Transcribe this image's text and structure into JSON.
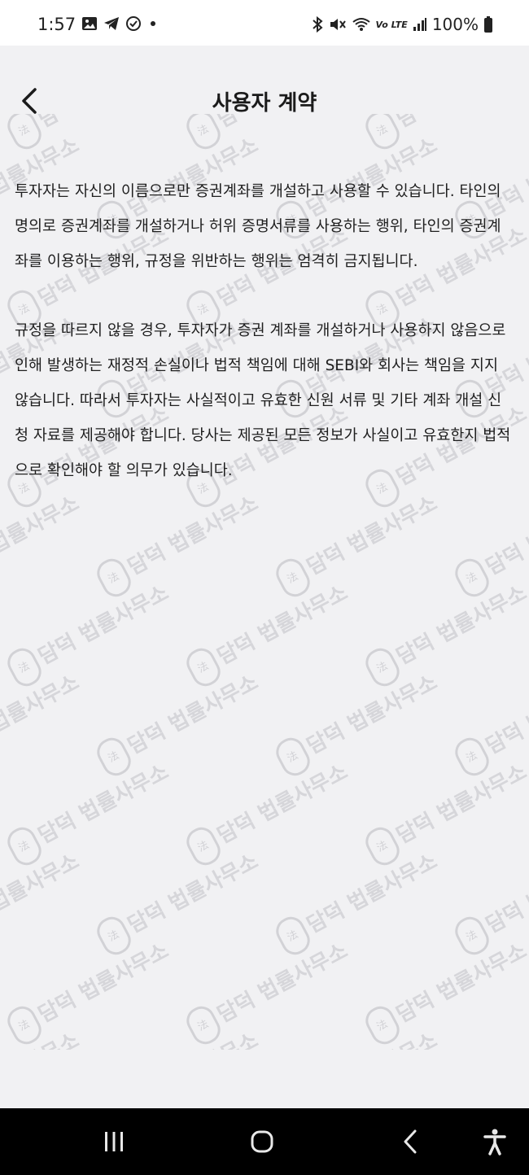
{
  "status_bar": {
    "time": "1:57",
    "left_icons": [
      "image-icon",
      "telegram-icon",
      "check-circle-icon",
      "dot-icon"
    ],
    "right_icons": [
      "bluetooth-icon",
      "mute-icon",
      "wifi-icon",
      "lte-icon",
      "signal-icon",
      "battery-icon"
    ],
    "lte_label": "Vo LTE",
    "battery": "100%"
  },
  "header": {
    "title": "사용자 계약",
    "back_icon": "chevron-left-icon"
  },
  "content": {
    "paragraphs": [
      "투자자는 자신의 이름으로만 증권계좌를 개설하고 사용할 수 있습니다. 타인의 명의로 증권계좌를 개설하거나 허위 증명서류를 사용하는 행위, 타인의 증권계좌를 이용하는 행위, 규정을 위반하는 행위는 엄격히 금지됩니다.",
      "규정을 따르지 않을 경우, 투자자가 증권 계좌를 개설하거나 사용하지 않음으로 인해 발생하는 재정적 손실이나 법적 책임에 대해 SEBI와 회사는 책임을 지지 않습니다. 따라서 투자자는 사실적이고 유효한 신원 서류 및 기타 계좌 개설 신청 자료를 제공해야 합니다. 당사는 제공된 모든 정보가 사실이고 유효한지 법적으로 확인해야 할 의무가 있습니다."
    ]
  },
  "watermark": {
    "text": "담덕 법률사무소",
    "color": "#d0d0d4"
  },
  "nav_bar": {
    "buttons": [
      "recent-apps-icon",
      "home-icon",
      "back-icon",
      "accessibility-icon"
    ]
  },
  "colors": {
    "background": "#f1f1f3",
    "status_bar": "#ffffff",
    "nav_bar": "#000000",
    "text": "#1f1f1f"
  }
}
